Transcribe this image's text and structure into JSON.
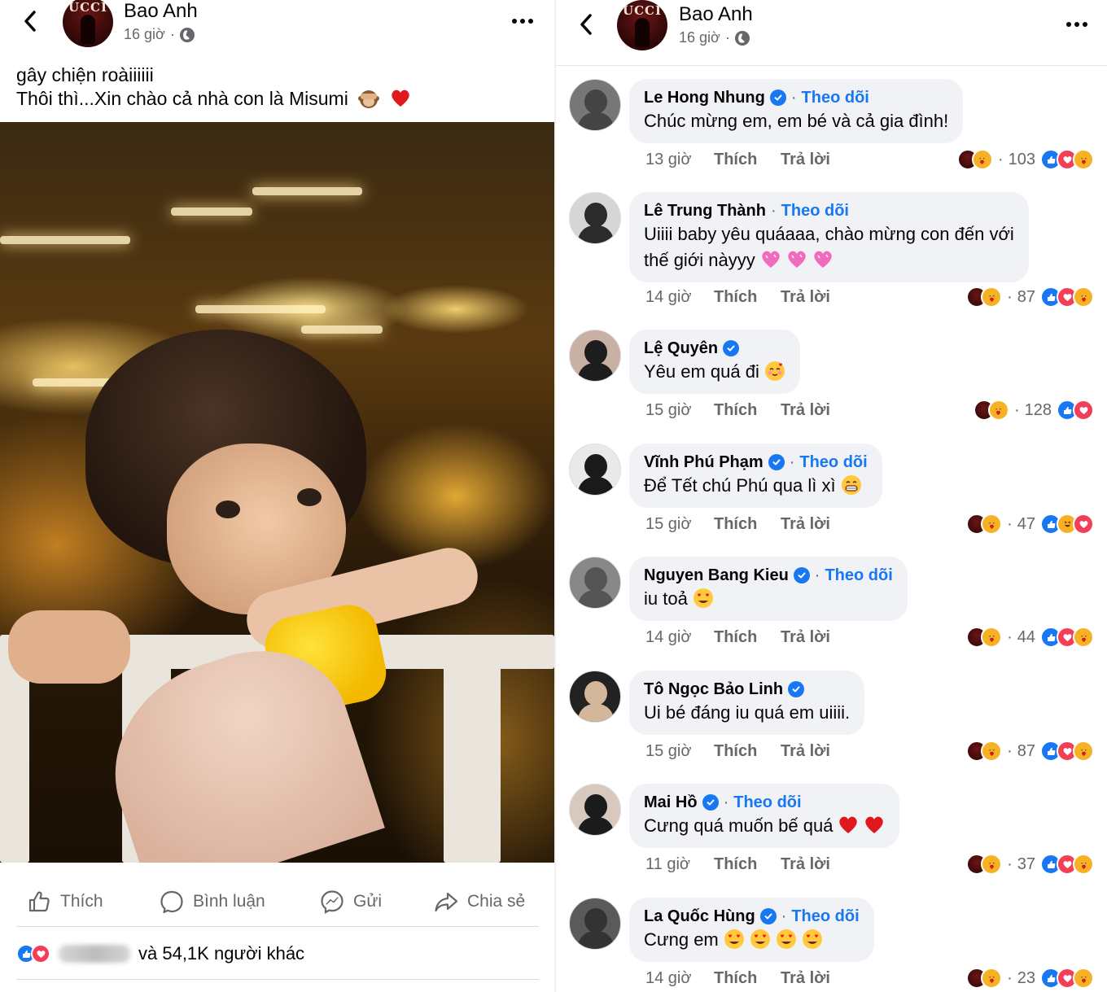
{
  "post": {
    "author": "Bao Anh",
    "time": "16 giờ",
    "avatar_text": "UCCI",
    "caption_line1": "gây chiện roàiiiiii",
    "caption_line2": "Thôi thì...Xin chào cả nhà con là Misumi",
    "caption_emojis": [
      "see-no-evil-monkey-icon",
      "red-heart-icon"
    ],
    "actions": {
      "like": "Thích",
      "comment": "Bình luận",
      "send": "Gửi",
      "share": "Chia sẻ"
    },
    "summary_text": "và 54,1K người khác"
  },
  "comments_header": {
    "author": "Bao Anh",
    "time": "16 giờ",
    "avatar_text": "UCCI"
  },
  "comment_labels": {
    "follow": "Theo dõi",
    "like": "Thích",
    "reply": "Trả lời"
  },
  "comments": [
    {
      "name": "Le Hong Nhung",
      "verified": true,
      "follow": true,
      "text": "Chúc mừng em, em bé và cả gia đình!",
      "time": "13 giờ",
      "count": "103",
      "reactions": [
        "like",
        "love",
        "care"
      ]
    },
    {
      "name": "Lê Trung Thành",
      "verified": false,
      "follow": true,
      "text": "Uiiii baby yêu quáaaa, chào mừng con đến với",
      "text2": "thế giới nàyyy",
      "time": "14 giờ",
      "count": "87",
      "reactions": [
        "like",
        "love",
        "care"
      ]
    },
    {
      "name": "Lệ Quyên",
      "verified": true,
      "follow": false,
      "text": "Yêu em quá đi",
      "time": "15 giờ",
      "count": "128",
      "reactions": [
        "like",
        "love"
      ]
    },
    {
      "name": "Vĩnh Phú Phạm",
      "verified": true,
      "follow": true,
      "text": "Để Tết chú Phú qua lì xì",
      "time": "15 giờ",
      "count": "47",
      "reactions": [
        "like",
        "haha",
        "love"
      ]
    },
    {
      "name": "Nguyen Bang Kieu",
      "verified": true,
      "follow": true,
      "text": "iu toả",
      "time": "14 giờ",
      "count": "44",
      "reactions": [
        "like",
        "love",
        "care"
      ]
    },
    {
      "name": "Tô Ngọc Bảo Linh",
      "verified": true,
      "follow": false,
      "text": "Ui bé đáng iu quá em uiiii.",
      "time": "15 giờ",
      "count": "87",
      "reactions": [
        "like",
        "love",
        "care"
      ]
    },
    {
      "name": "Mai Hồ",
      "verified": true,
      "follow": true,
      "text": "Cưng quá muốn bế quá",
      "time": "11 giờ",
      "count": "37",
      "reactions": [
        "like",
        "love",
        "care"
      ]
    },
    {
      "name": "La Quốc Hùng",
      "verified": true,
      "follow": true,
      "text": "Cưng em",
      "time": "14 giờ",
      "count": "23",
      "reactions": [
        "like",
        "love",
        "care"
      ]
    }
  ],
  "colors": {
    "facebook_blue": "#1877f2",
    "secondary_text": "#65676b",
    "bubble_bg": "#f0f2f5",
    "love_red": "#f33e58"
  }
}
